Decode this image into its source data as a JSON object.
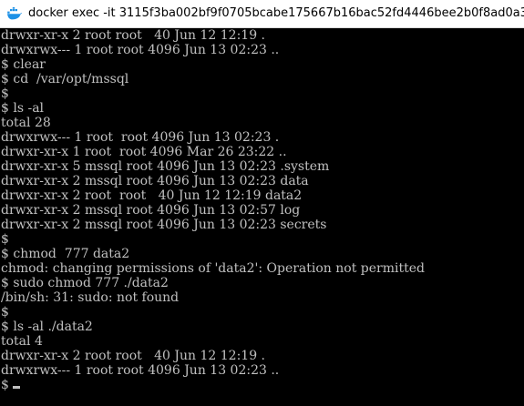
{
  "window": {
    "title": "docker  exec -it 3115f3ba002bf9f0705bcabe175667b16bac52fd4446bee2b0f8ad0a339e8",
    "icon": "docker-whale-icon",
    "background": "#000000",
    "foreground": "#c0c0c0",
    "accent": "#1d91e6"
  },
  "terminal": {
    "lines": [
      "drwxr-xr-x 2 root root   40 Jun 12 12:19 .",
      "drwxrwx--- 1 root root 4096 Jun 13 02:23 ..",
      "$ clear",
      "$ cd  /var/opt/mssql",
      "$",
      "$ ls -al",
      "total 28",
      "drwxrwx--- 1 root  root 4096 Jun 13 02:23 .",
      "drwxr-xr-x 1 root  root 4096 Mar 26 23:22 ..",
      "drwxr-xr-x 5 mssql root 4096 Jun 13 02:23 .system",
      "drwxr-xr-x 2 mssql root 4096 Jun 13 02:23 data",
      "drwxr-xr-x 2 root  root   40 Jun 12 12:19 data2",
      "drwxr-xr-x 2 mssql root 4096 Jun 13 02:57 log",
      "drwxr-xr-x 2 mssql root 4096 Jun 13 02:23 secrets",
      "$",
      "$ chmod  777 data2",
      "chmod: changing permissions of 'data2': Operation not permitted",
      "$ sudo chmod 777 ./data2",
      "/bin/sh: 31: sudo: not found",
      "$",
      "$ ls -al ./data2",
      "total 4",
      "drwxr-xr-x 2 root root   40 Jun 12 12:19 .",
      "drwxrwx--- 1 root root 4096 Jun 13 02:23 ..",
      "$ "
    ]
  }
}
